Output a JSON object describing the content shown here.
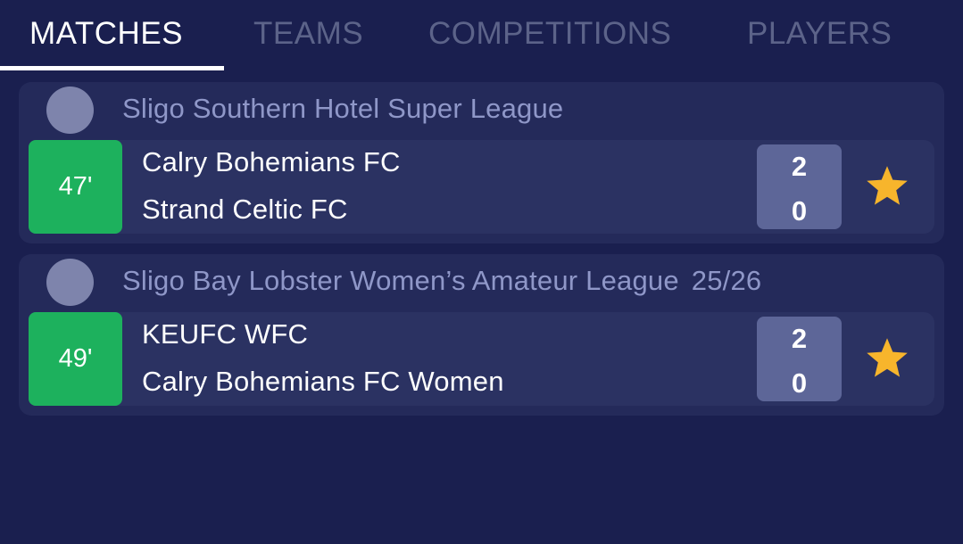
{
  "tabs": [
    {
      "label": "MATCHES",
      "active": true
    },
    {
      "label": "TEAMS",
      "active": false
    },
    {
      "label": "COMPETITIONS",
      "active": false
    },
    {
      "label": "PLAYERS",
      "active": false
    }
  ],
  "leagues": [
    {
      "name": "Sligo Southern Hotel Super League",
      "season": "",
      "matches": [
        {
          "minute": "47'",
          "home_team": "Calry Bohemians FC",
          "away_team": "Strand Celtic FC",
          "home_score": "2",
          "away_score": "0",
          "favorite_icon": "star-icon"
        }
      ]
    },
    {
      "name": "Sligo Bay Lobster Women’s Amateur League",
      "season": "25/26",
      "matches": [
        {
          "minute": "49'",
          "home_team": "KEUFC WFC",
          "away_team": "Calry Bohemians FC Women",
          "home_score": "2",
          "away_score": "0",
          "favorite_icon": "star-icon"
        }
      ]
    }
  ],
  "colors": {
    "background": "#1a1f4f",
    "card": "#242a5a",
    "match_row": "#2b3262",
    "live_minute": "#1db15d",
    "score_box": "#5d6698",
    "league_text": "#8f97c8",
    "tab_inactive": "#5c6389",
    "star": "#f7b52c"
  }
}
